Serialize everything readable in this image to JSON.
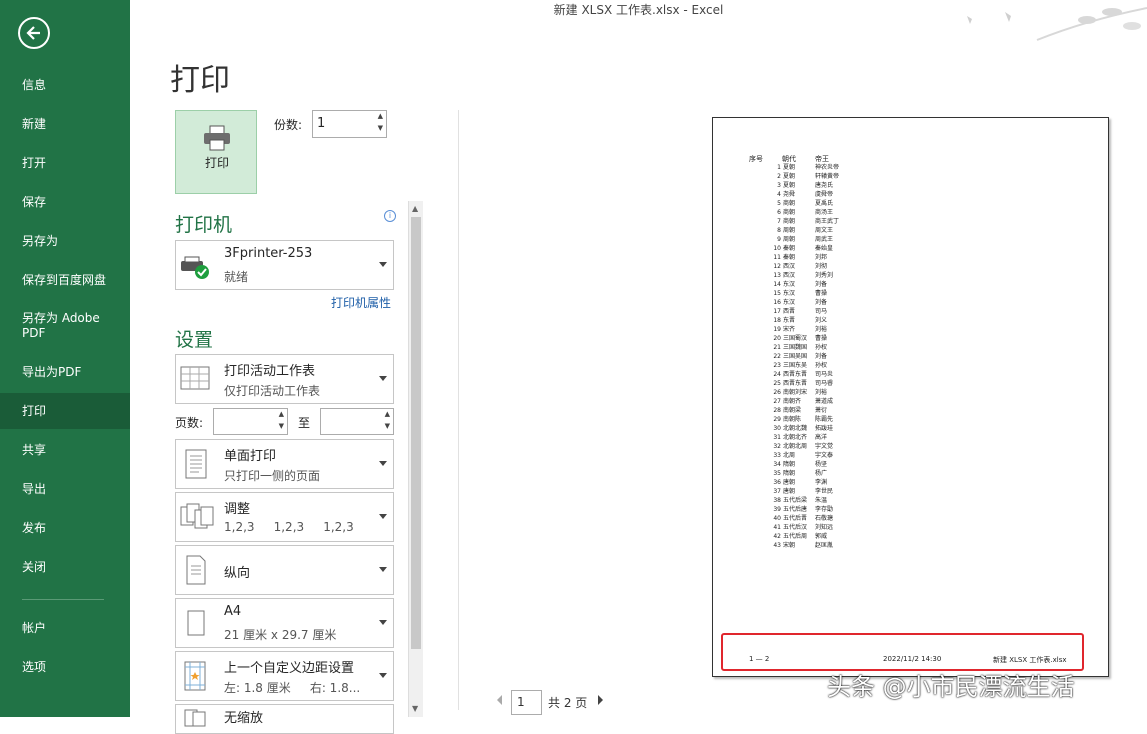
{
  "window": {
    "title": "新建 XLSX 工作表.xlsx - Excel"
  },
  "sidebar": {
    "items": [
      {
        "label": "信息",
        "active": false
      },
      {
        "label": "新建",
        "active": false
      },
      {
        "label": "打开",
        "active": false
      },
      {
        "label": "保存",
        "active": false
      },
      {
        "label": "另存为",
        "active": false
      },
      {
        "label": "保存到百度网盘",
        "active": false
      },
      {
        "label": "另存为 Adobe PDF",
        "active": false
      },
      {
        "label": "导出为PDF",
        "active": false
      },
      {
        "label": "打印",
        "active": true
      },
      {
        "label": "共享",
        "active": false
      },
      {
        "label": "导出",
        "active": false
      },
      {
        "label": "发布",
        "active": false
      },
      {
        "label": "关闭",
        "active": false
      }
    ],
    "bottom_items": [
      {
        "label": "帐户"
      },
      {
        "label": "选项"
      }
    ]
  },
  "print": {
    "heading": "打印",
    "button_label": "打印",
    "copies_label": "份数:",
    "copies_value": "1",
    "printer_section": "打印机",
    "printer_name": "3Fprinter-253",
    "printer_status": "就绪",
    "printer_props": "打印机属性",
    "settings_section": "设置",
    "pages_label": "页数:",
    "pages_to": "至",
    "pages_from_value": "",
    "pages_to_value": ""
  },
  "settings": {
    "scope": {
      "t1": "打印活动工作表",
      "t2": "仅打印活动工作表"
    },
    "sides": {
      "t1": "单面打印",
      "t2": "只打印一侧的页面"
    },
    "collate": {
      "t1": "调整",
      "t2": "1,2,3     1,2,3     1,2,3"
    },
    "orientation": {
      "t1": "纵向"
    },
    "paper": {
      "t1": "A4",
      "t2": "21 厘米 x 29.7 厘米"
    },
    "margins": {
      "t1": "上一个自定义边距设置",
      "t2": "左: 1.8 厘米     右: 1.8..."
    },
    "scaling": {
      "t1": "无缩放"
    }
  },
  "preview": {
    "headers": [
      "序号",
      "朝代",
      "帝王"
    ],
    "rows": [
      [
        "1",
        "夏朝",
        "神农炎帝"
      ],
      [
        "2",
        "夏朝",
        "轩辕黄帝"
      ],
      [
        "3",
        "夏朝",
        "唐尧氏"
      ],
      [
        "4",
        "尧舜",
        "虞舜帝"
      ],
      [
        "5",
        "商朝",
        "夏禹氏"
      ],
      [
        "6",
        "商朝",
        "商汤王"
      ],
      [
        "7",
        "商朝",
        "商王武丁"
      ],
      [
        "8",
        "周朝",
        "周文王"
      ],
      [
        "9",
        "周朝",
        "周武王"
      ],
      [
        "10",
        "秦朝",
        "秦始皇"
      ],
      [
        "11",
        "秦朝",
        "刘邦"
      ],
      [
        "12",
        "西汉",
        "刘彻"
      ],
      [
        "13",
        "西汉",
        "刘秀刘"
      ],
      [
        "14",
        "东汉",
        "刘备"
      ],
      [
        "15",
        "东汉",
        "曹操"
      ],
      [
        "16",
        "东汉",
        "刘备"
      ],
      [
        "17",
        "西晋",
        "司马"
      ],
      [
        "18",
        "东晋",
        "刘义"
      ],
      [
        "19",
        "宋齐",
        "刘裕"
      ],
      [
        "20",
        "三国蜀汉",
        "曹操"
      ],
      [
        "21",
        "三国魏国",
        "孙权"
      ],
      [
        "22",
        "三国吴国",
        "刘备"
      ],
      [
        "23",
        "三国东吴",
        "孙权"
      ],
      [
        "24",
        "西晋东晋",
        "司马炎"
      ],
      [
        "25",
        "西晋东晋",
        "司马睿"
      ],
      [
        "26",
        "南朝刘宋",
        "刘裕"
      ],
      [
        "27",
        "南朝齐",
        "萧道成"
      ],
      [
        "28",
        "南朝梁",
        "萧衍"
      ],
      [
        "29",
        "南朝陈",
        "陈霸先"
      ],
      [
        "30",
        "北朝北魏",
        "拓跋珪"
      ],
      [
        "31",
        "北朝北齐",
        "高洋"
      ],
      [
        "32",
        "北朝北周",
        "宇文觉"
      ],
      [
        "33",
        "北周",
        "宇文泰"
      ],
      [
        "34",
        "隋朝",
        "杨坚"
      ],
      [
        "35",
        "隋朝",
        "杨广"
      ],
      [
        "36",
        "唐朝",
        "李渊"
      ],
      [
        "37",
        "唐朝",
        "李世民"
      ],
      [
        "38",
        "五代后梁",
        "朱温"
      ],
      [
        "39",
        "五代后唐",
        "李存勖"
      ],
      [
        "40",
        "五代后晋",
        "石敬瑭"
      ],
      [
        "41",
        "五代后汉",
        "刘知远"
      ],
      [
        "42",
        "五代后周",
        "郭威"
      ],
      [
        "43",
        "宋朝",
        "赵匡胤"
      ]
    ],
    "footer_left": "1 — 2",
    "footer_mid": "2022/11/2  14:30",
    "footer_right": "新建 XLSX 工作表.xlsx",
    "page_current": "1",
    "page_total": "共 2 页"
  },
  "watermark": "头条 @小市民漂流生活",
  "colors": {
    "accent": "#217346",
    "highlight": "#e0262d"
  }
}
